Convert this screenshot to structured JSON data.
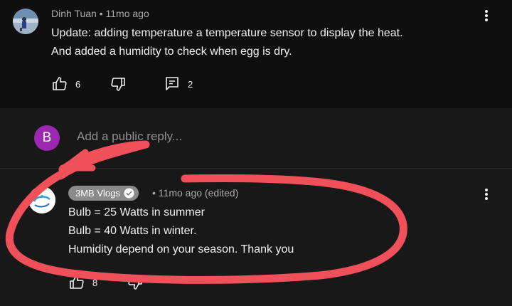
{
  "comment": {
    "author": "Dinh Tuan",
    "time": "• 11mo ago",
    "lines": [
      "Update: adding temperature a temperature sensor to display the heat.",
      "And added a humidity to check when egg is dry."
    ],
    "like_count": "6",
    "reply_count": "2",
    "avatar_icon": "user-photo"
  },
  "reply_box": {
    "avatar_letter": "B",
    "avatar_color": "#9c27b0",
    "placeholder": "Add a public reply..."
  },
  "reply": {
    "author": "3MB Vlogs",
    "verified_icon": "check-circle",
    "time": "• 11mo ago (edited)",
    "lines": [
      "Bulb = 25 Watts in summer",
      "Bulb = 40 Watts in winter.",
      "Humidity depend on your season. Thank you"
    ],
    "like_count": "8",
    "channel_logo_icon": "channel-logo"
  },
  "annotation": {
    "color": "#f0505a",
    "shape": "hand-drawn arrow loop"
  }
}
